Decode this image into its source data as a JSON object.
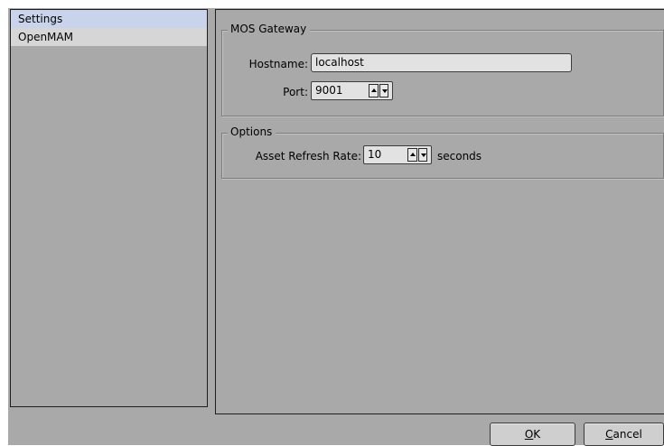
{
  "sidebar": {
    "items": [
      {
        "label": "Settings",
        "selected": true
      },
      {
        "label": "OpenMAM",
        "selected": false
      }
    ]
  },
  "mos_gateway": {
    "title": "MOS Gateway",
    "hostname_label": "Hostname:",
    "hostname_value": "localhost",
    "port_label": "Port:",
    "port_value": "9001"
  },
  "options": {
    "title": "Options",
    "refresh_label": "Asset Refresh Rate:",
    "refresh_value": "10",
    "refresh_unit": "seconds"
  },
  "buttons": {
    "ok_mnemonic": "O",
    "ok_rest": "K",
    "cancel_mnemonic": "C",
    "cancel_rest": "ancel"
  },
  "colors": {
    "dialog_bg": "#a9a9a9",
    "selected_item": "#c9d3ec",
    "input_bg": "#e2e2e2"
  },
  "icons": {
    "spin_up": "triangle-up-icon",
    "spin_down": "triangle-down-icon"
  }
}
